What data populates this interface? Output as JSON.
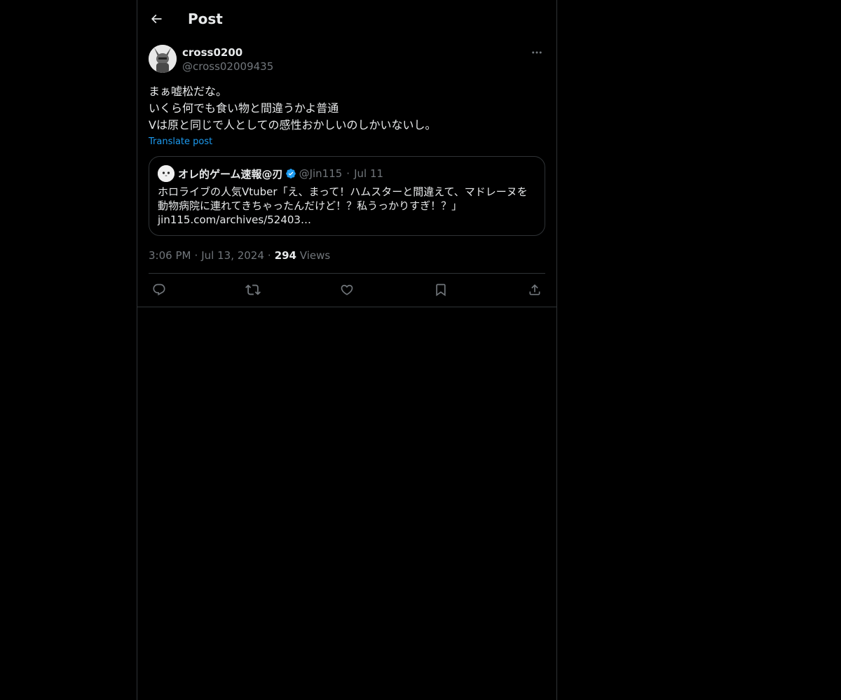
{
  "header": {
    "title": "Post"
  },
  "post": {
    "author": {
      "display_name": "cross0200",
      "handle": "@cross02009435"
    },
    "text": "まぁ嘘松だな。\nいくら何でも食い物と間違うかよ普通\nVは原と同じで人としての感性おかしいのしかいないし。",
    "translate_label": "Translate post",
    "quote": {
      "display_name": "オレ的ゲーム速報@刃",
      "handle": "@Jin115",
      "separator": "·",
      "date": "Jul 11",
      "text": "ホロライブの人気Vtuber「え、まって！ハムスターと間違えて、マドレーヌを動物病院に連れてきちゃったんだけど！？私うっかりすぎ！？」",
      "link": "jin115.com/archives/52403…"
    },
    "meta": {
      "time": "3:06 PM",
      "separator": "·",
      "date": "Jul 13, 2024",
      "views_count": "294",
      "views_label": "Views"
    },
    "actions": {
      "icons": [
        "reply-icon",
        "repost-icon",
        "like-icon",
        "bookmark-icon",
        "share-icon"
      ]
    }
  },
  "colors": {
    "background": "#000000",
    "text_primary": "#e7e9ea",
    "text_secondary": "#71767b",
    "accent": "#1d9bf0",
    "border": "#2f3336"
  }
}
